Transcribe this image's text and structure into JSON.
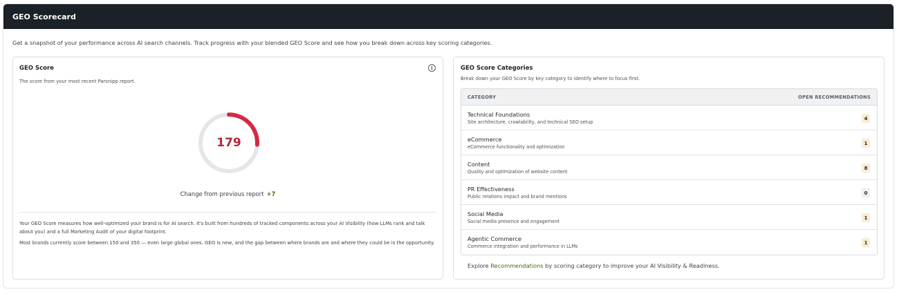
{
  "header": {
    "title": "GEO Scorecard"
  },
  "intro": "Get a snapshot of your performance across AI search channels. Track progress with your blended GEO Score and see how you break down across key scoring categories.",
  "score_card": {
    "title": "GEO Score",
    "subtitle": "The score from your most recent Parsnipp report.",
    "score": "179",
    "score_progress": 0.26,
    "accent_color": "#d32a43",
    "track_color": "#e4e6ea",
    "change_label": "Change from previous report",
    "change_value": "+7",
    "description_1": "Your GEO Score measures how well-optimized your brand is for AI search. It's built from hundreds of tracked components across your AI Visibility (how LLMs rank and talk about you) and a full Marketing Audit of your digital footprint.",
    "description_2": "Most brands currently score between 150 and 350 — even large global ones. GEO is new, and the gap between where brands are and where they could be is the opportunity."
  },
  "categories_card": {
    "title": "GEO Score Categories",
    "subtitle": "Break down your GEO Score by key category to identify where to focus first.",
    "columns": {
      "category": "CATEGORY",
      "open": "OPEN RECOMMENDATIONS"
    },
    "rows": [
      {
        "name": "Technical Foundations",
        "desc": "Site architecture, crawlability, and technical SEO setup",
        "count": "4"
      },
      {
        "name": "eCommerce",
        "desc": "eCommerce functionality and optimization",
        "count": "1"
      },
      {
        "name": "Content",
        "desc": "Quality and optimization of website content",
        "count": "8"
      },
      {
        "name": "PR Effectiveness",
        "desc": "Public relations impact and brand mentions",
        "count": "0"
      },
      {
        "name": "Social Media",
        "desc": "Social media presence and engagement",
        "count": "1"
      },
      {
        "name": "Agentic Commerce",
        "desc": "Commerce integration and performance in LLMs",
        "count": "1"
      }
    ],
    "footer_prefix": "Explore",
    "footer_link": "Recommendations",
    "footer_suffix": "by scoring category to improve your AI Visibility & Readiness."
  }
}
